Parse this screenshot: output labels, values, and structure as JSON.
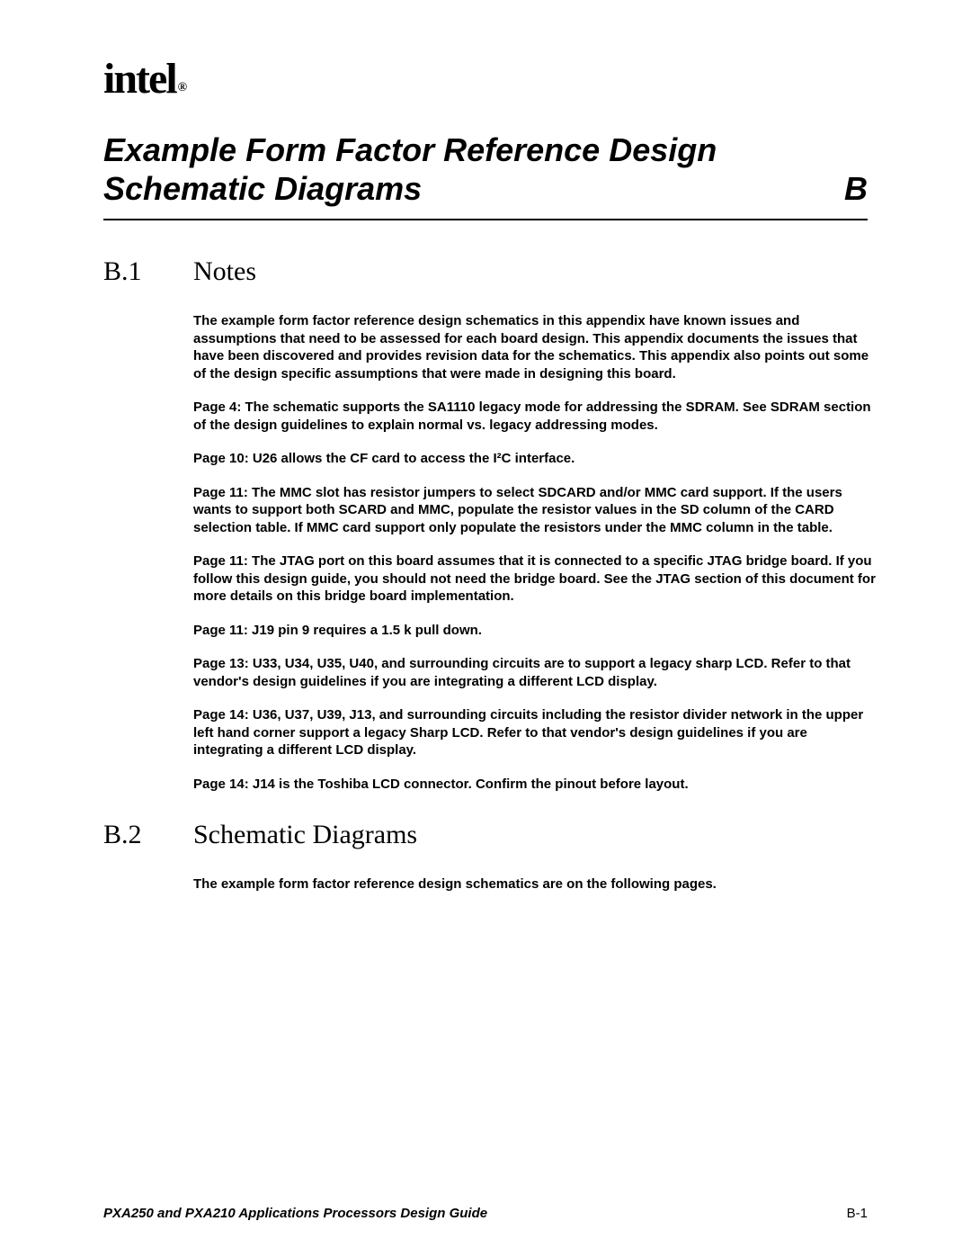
{
  "logo": {
    "text": "intel",
    "reg": "®"
  },
  "title": "Example Form Factor Reference Design Schematic Diagrams",
  "title_letter": "B",
  "sections": {
    "b1": {
      "num": "B.1",
      "label": "Notes",
      "paragraphs": [
        "The example form factor reference design schematics in this appendix have known issues and assumptions that need to be assessed for each board design. This appendix documents the issues that have been discovered and provides revision data for the schematics. This appendix also points out some of the design specific assumptions that were made in designing this board.",
        "Page 4: The schematic supports the SA1110 legacy mode for addressing the SDRAM. See SDRAM section of the design guidelines to explain normal vs. legacy addressing modes.",
        "Page 10: U26 allows the CF card to access the I²C interface.",
        "Page 11: The MMC slot has resistor jumpers to select SDCARD and/or MMC card support. If the users wants to support both SCARD and MMC, populate the resistor values in the SD column of the CARD selection table. If MMC card support only populate the resistors under the MMC column in the table.",
        "Page 11: The JTAG port on this board assumes that it is connected to a specific JTAG bridge board. If you follow this design guide, you should not need the bridge board. See the JTAG section of this document for more details on this bridge board implementation.",
        "Page 11: J19 pin 9 requires a 1.5 k pull down.",
        "Page 13: U33, U34, U35, U40, and surrounding circuits are to support a legacy sharp LCD. Refer to that vendor's design guidelines if you are integrating a different LCD display.",
        "Page 14: U36, U37, U39, J13, and surrounding circuits including the resistor divider network in the upper left hand corner support a legacy Sharp LCD. Refer to that vendor's design guidelines if you are integrating a different LCD display.",
        "Page 14: J14 is the Toshiba LCD connector. Confirm the pinout before layout."
      ]
    },
    "b2": {
      "num": "B.2",
      "label": "Schematic Diagrams",
      "paragraphs": [
        "The example form factor reference design schematics are on the following pages."
      ]
    }
  },
  "footer": {
    "left": "PXA250 and PXA210 Applications Processors Design Guide",
    "right": "B-1"
  }
}
